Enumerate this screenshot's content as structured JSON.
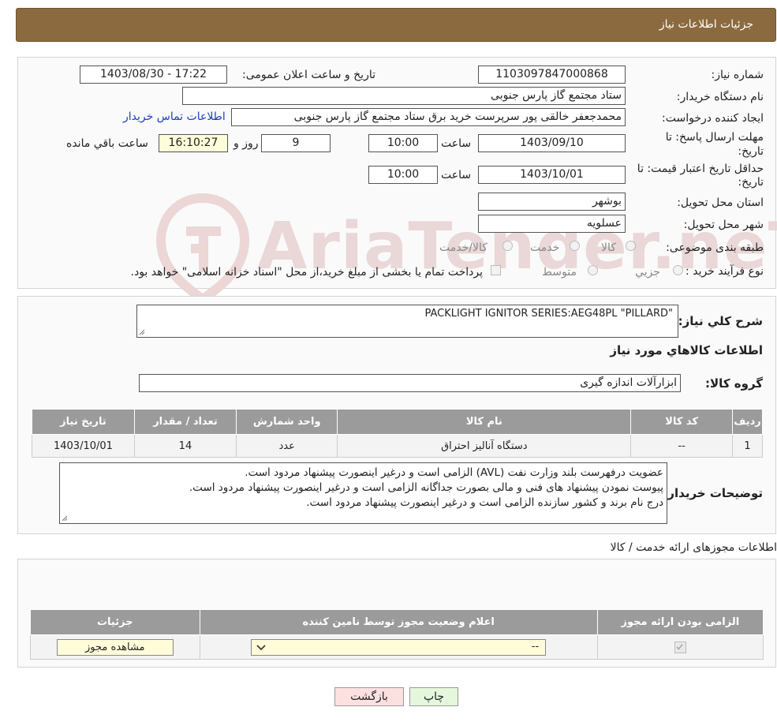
{
  "header": {
    "title": "جزئیات اطلاعات نیاز"
  },
  "watermark": "AriaTender.neT",
  "form": {
    "need_number_label": "شماره نیاز:",
    "need_number": "1103097847000868",
    "announce_label": "تاریخ و ساعت اعلان عمومی:",
    "announce_value": "1403/08/30 - 17:22",
    "buyer_org_label": "نام دستگاه خریدار:",
    "buyer_org": "ستاد مجتمع گاز پارس جنوبی",
    "creator_label": "ایجاد کننده درخواست:",
    "creator": "محمدجعفر خالقی پور سرپرست خرید برق ستاد مجتمع گاز پارس جنوبی",
    "contact_link": "اطلاعات تماس خریدار",
    "reply_deadline_label1": "مهلت ارسال پاسخ: تا",
    "reply_deadline_label2": "تاریخ:",
    "reply_date": "1403/09/10",
    "time_label": "ساعت",
    "reply_time": "10:00",
    "days": "9",
    "days_label": "روز و",
    "remaining_time": "16:10:27",
    "remaining_label": "ساعت باقي مانده",
    "validity_label1": "حداقل تاریخ اعتبار قیمت: تا",
    "validity_label2": "تاریخ:",
    "validity_date": "1403/10/01",
    "validity_time": "10:00",
    "province_label": "استان محل تحویل:",
    "province": "بوشهر",
    "city_label": "شهر محل تحویل:",
    "city": "عسلویه",
    "category_label": "طبقه بندی موضوعی:",
    "category_options": [
      "کالا",
      "خدمت",
      "کالا/خدمت"
    ],
    "process_label": "نوع فرآیند خرید :",
    "process_options": [
      "جزیي",
      "متوسط"
    ],
    "process_note": "پرداخت تمام یا بخشی از مبلغ خرید،از محل \"اسناد خزانه اسلامی\" خواهد بود."
  },
  "details": {
    "summary_label": "شرح کلي نیاز:",
    "summary": "PACKLIGHT IGNITOR SERIES:AEG48PL \"PILLARD\"",
    "goods_info_title": "اطلاعات کالاهاي مورد نياز",
    "group_label": "گروه کالا:",
    "group_value": "ابزارآلات اندازه گیری",
    "table_headers": [
      "رديف",
      "کد کالا",
      "نام کالا",
      "واحد شمارش",
      "تعداد / مقدار",
      "تاریخ نیاز"
    ],
    "rows": [
      [
        "1",
        "--",
        "دستگاه آنالیز احتراق",
        "عدد",
        "14",
        "1403/10/01"
      ]
    ],
    "buyer_notes_label": "توضیحات خریدار:",
    "buyer_notes": [
      "عضویت درفهرست بلند وزارت نفت (AVL) الزامی است و درغیر اینصورت پیشنهاد مردود است.",
      "پیوست نمودن پیشنهاد های فنی و مالی بصورت جداگانه الزامی است و درغیر اینصورت پیشنهاد مردود است.",
      "درج نام برند و کشور سازنده الزامی است و درغیر اینصورت پیشنهاد مردود است."
    ]
  },
  "licenses": {
    "title": "اطلاعات مجوزهای ارائه خدمت / کالا",
    "headers": [
      "الزامی بودن ارائه مجوز",
      "اعلام وضعیت مجوز توسط نامین کننده",
      "جزئیات"
    ],
    "select_value": "--",
    "view_button": "مشاهده مجوز"
  },
  "buttons": {
    "print": "چاپ",
    "back": "بازگشت"
  }
}
